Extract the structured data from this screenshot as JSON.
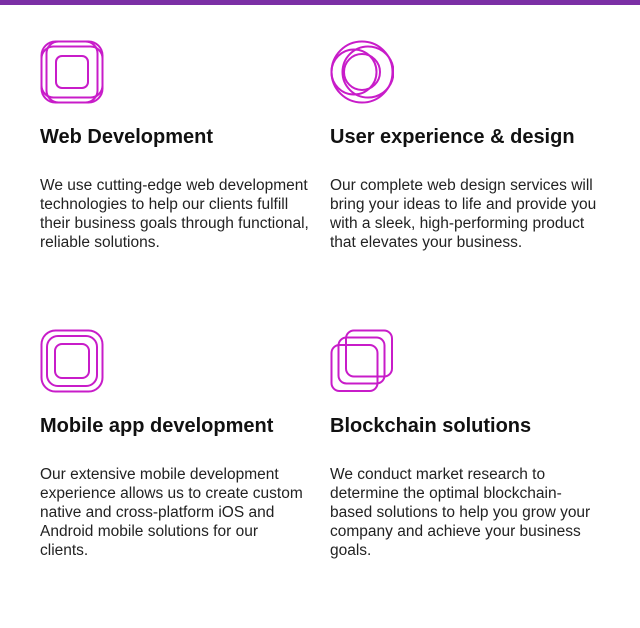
{
  "theme": {
    "accent": "#c81cc9",
    "top_bar": "#7b2fa5"
  },
  "services": [
    {
      "icon": "nested-rounded-squares-icon",
      "title": "Web Development",
      "description": "We use cutting-edge web development technologies to help our clients fulfill their business goals through functional, reliable solutions."
    },
    {
      "icon": "overlapping-circles-icon",
      "title": "User experience & design",
      "description": "Our complete web design services will bring your ideas to life and provide you with a sleek, high-performing product that elevates your business."
    },
    {
      "icon": "concentric-rounded-squares-icon",
      "title": "Mobile app development",
      "description": "Our extensive mobile development experience allows us to create custom native and cross-platform iOS and Android mobile solutions for our clients."
    },
    {
      "icon": "stacked-squares-icon",
      "title": "Blockchain solutions",
      "description": "We conduct market research to determine the optimal blockchain-based solutions to help you grow your company and achieve your business goals."
    }
  ]
}
